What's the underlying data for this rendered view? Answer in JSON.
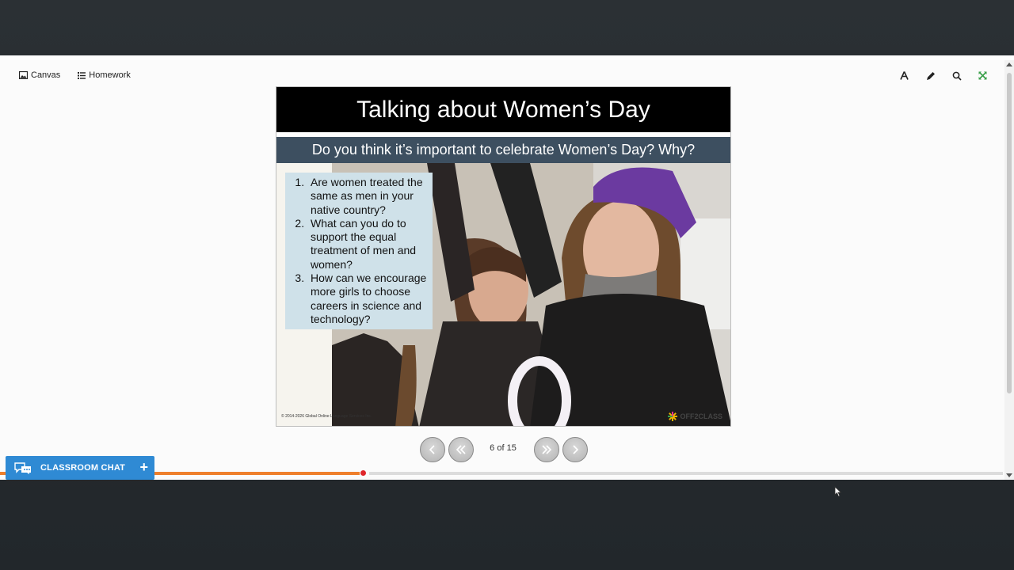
{
  "toolbar": {
    "canvas_label": "Canvas",
    "homework_label": "Homework",
    "tools": [
      "font-icon",
      "pencil-icon",
      "search-icon",
      "fullscreen-icon"
    ]
  },
  "slide": {
    "title": "Talking about Women’s Day",
    "question": "Do you think it’s important to celebrate Women’s Day? Why?",
    "items": [
      "Are women treated the same as men in your native country?",
      "What can you do to support the equal treatment of men and women?",
      "How can we encourage more girls to choose careers in science and technology?"
    ],
    "copyright": "© 2014-2026 Global Online Language Services Inc.",
    "logo_text": "OFF2CLASS"
  },
  "navigation": {
    "page_indicator": "6 of 15",
    "current_page": 6,
    "total_pages": 15
  },
  "progress": {
    "fraction": 0.36
  },
  "chat": {
    "label": "CLASSROOM CHAT",
    "plus": "+"
  },
  "colors": {
    "accent_orange": "#ef7f2b",
    "chat_blue": "#2f8ad4",
    "slide_header": "#000000",
    "question_bar": "#3d4f60",
    "question_box": "#cfe1e9",
    "fullscreen_green": "#3aa04a"
  }
}
